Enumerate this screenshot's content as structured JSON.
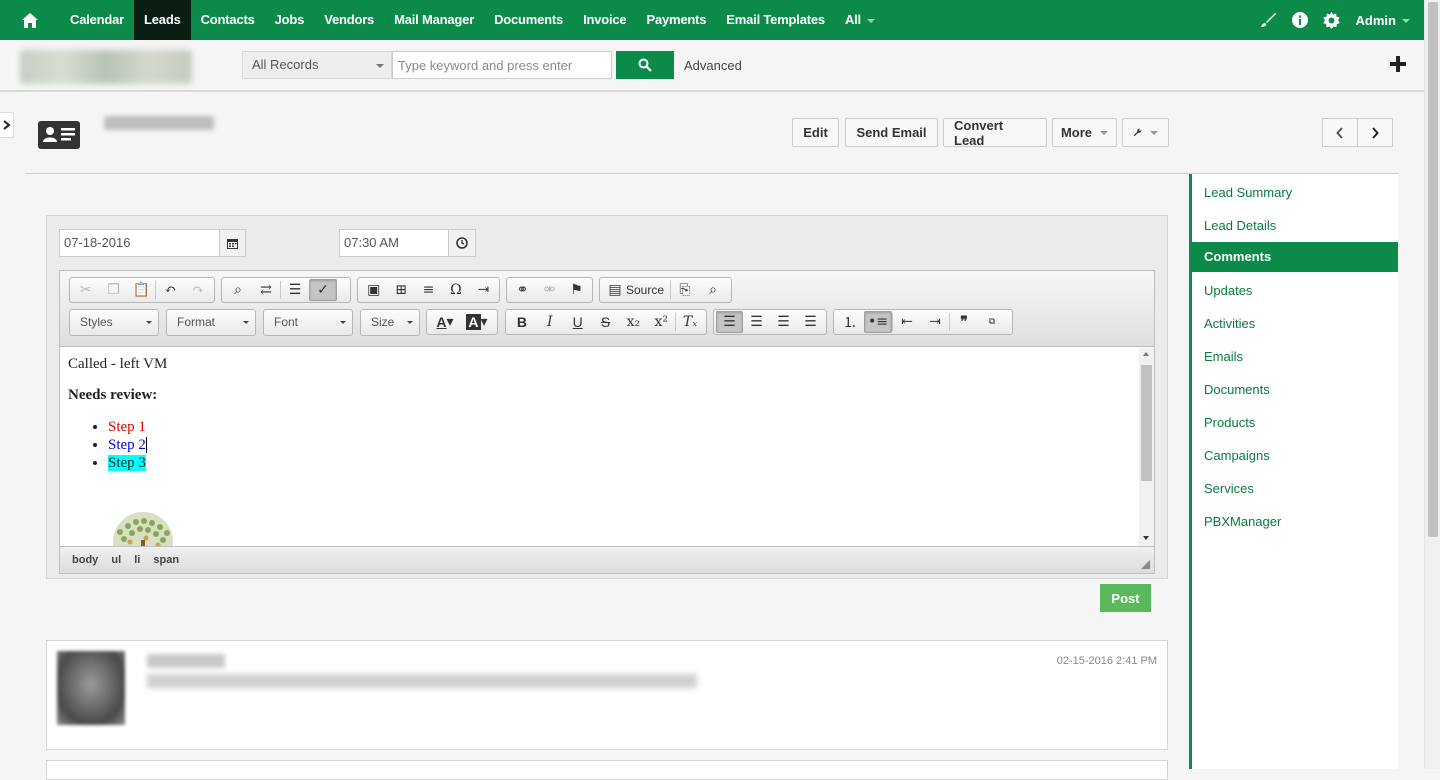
{
  "nav": {
    "items": [
      "Calendar",
      "Leads",
      "Contacts",
      "Jobs",
      "Vendors",
      "Mail Manager",
      "Documents",
      "Invoice",
      "Payments",
      "Email Templates",
      "All"
    ],
    "active": "Leads",
    "user": "Admin"
  },
  "search": {
    "scope": "All Records",
    "placeholder": "Type keyword and press enter",
    "advanced": "Advanced"
  },
  "record": {
    "actions": {
      "edit": "Edit",
      "send_email": "Send Email",
      "convert_lead": "Convert Lead",
      "more": "More"
    }
  },
  "sidebar": {
    "items": [
      "Lead Summary",
      "Lead Details",
      "Comments",
      "Updates",
      "Activities",
      "Emails",
      "Documents",
      "Products",
      "Campaigns",
      "Services",
      "PBXManager"
    ],
    "active": "Comments"
  },
  "comment_form": {
    "date": "07-18-2016",
    "time": "07:30 AM",
    "combos": {
      "styles": "Styles",
      "format": "Format",
      "font": "Font",
      "size": "Size"
    },
    "source_label": "Source",
    "content": {
      "line1": "Called - left VM",
      "heading": "Needs review:",
      "steps": [
        {
          "text": "Step 1",
          "color": "#e00000"
        },
        {
          "text": "Step 2",
          "color": "#0000e0"
        },
        {
          "text": "Step 3",
          "highlight": "#00ffff"
        }
      ]
    },
    "path": [
      "body",
      "ul",
      "li",
      "span"
    ],
    "post": "Post"
  },
  "comments": [
    {
      "timestamp": "02-15-2016 2:41 PM"
    }
  ]
}
